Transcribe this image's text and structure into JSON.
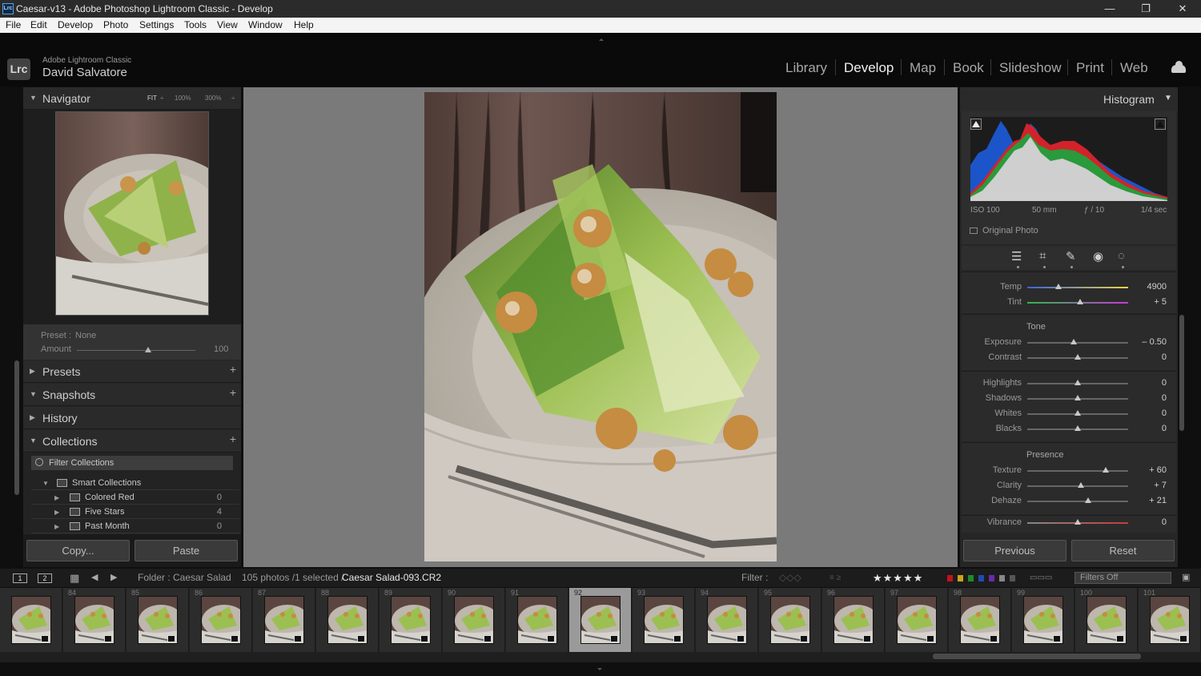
{
  "window": {
    "title": "Caesar-v13 - Adobe Photoshop Lightroom Classic - Develop",
    "icon_text": "Lrc"
  },
  "menu": [
    "File",
    "Edit",
    "Develop",
    "Photo",
    "Settings",
    "Tools",
    "View",
    "Window",
    "Help"
  ],
  "identity": {
    "logo": "Lrc",
    "app": "Adobe Lightroom Classic",
    "user": "David Salvatore"
  },
  "modules": [
    "Library",
    "Develop",
    "Map",
    "Book",
    "Slideshow",
    "Print",
    "Web"
  ],
  "active_module": "Develop",
  "navigator": {
    "title": "Navigator",
    "zoom": [
      "FIT",
      "100%",
      "300%"
    ],
    "zoom_selected": "FIT"
  },
  "preset": {
    "label": "Preset :",
    "value": "None",
    "amount_label": "Amount",
    "amount_value": "100",
    "amount_fraction": 0.6
  },
  "panels": {
    "presets": "Presets",
    "snapshots": "Snapshots",
    "history": "History",
    "collections": "Collections"
  },
  "collections": {
    "filter_placeholder": "Filter Collections",
    "smart": "Smart Collections",
    "items": [
      {
        "name": "Colored Red",
        "count": "0"
      },
      {
        "name": "Five Stars",
        "count": "4"
      },
      {
        "name": "Past Month",
        "count": "0"
      }
    ]
  },
  "left_buttons": {
    "copy": "Copy...",
    "paste": "Paste"
  },
  "histogram": {
    "title": "Histogram",
    "exif": {
      "iso": "ISO 100",
      "focal": "50 mm",
      "aperture": "ƒ / 10",
      "shutter": "1/4 sec"
    },
    "original_photo": "Original Photo"
  },
  "basic": {
    "sliders_top": [
      {
        "label": "Temp",
        "value": "4900",
        "pos": 0.31
      },
      {
        "label": "Tint",
        "value": "+ 5",
        "pos": 0.52
      }
    ],
    "tone_label": "Tone",
    "tone": [
      {
        "label": "Exposure",
        "value": "– 0.50",
        "pos": 0.46
      },
      {
        "label": "Contrast",
        "value": "0",
        "pos": 0.5
      }
    ],
    "tone2": [
      {
        "label": "Highlights",
        "value": "0",
        "pos": 0.5
      },
      {
        "label": "Shadows",
        "value": "0",
        "pos": 0.5
      },
      {
        "label": "Whites",
        "value": "0",
        "pos": 0.5
      },
      {
        "label": "Blacks",
        "value": "0",
        "pos": 0.5
      }
    ],
    "presence_label": "Presence",
    "presence": [
      {
        "label": "Texture",
        "value": "+ 60",
        "pos": 0.78
      },
      {
        "label": "Clarity",
        "value": "+ 7",
        "pos": 0.53
      },
      {
        "label": "Dehaze",
        "value": "+ 21",
        "pos": 0.6
      }
    ],
    "vibrance": {
      "label": "Vibrance",
      "value": "0",
      "pos": 0.5
    }
  },
  "right_buttons": {
    "previous": "Previous",
    "reset": "Reset"
  },
  "filmstrip_bar": {
    "screen1": "1",
    "screen2": "2",
    "folder": "Folder : Caesar Salad",
    "count": "105 photos /1 selected /",
    "file": "Caesar Salad-093.CR2",
    "filter_label": "Filter :",
    "stars": "★★★★★",
    "filters_off": "Filters Off"
  },
  "filmstrip": {
    "numbers": [
      "",
      "84",
      "85",
      "86",
      "87",
      "88",
      "89",
      "90",
      "91",
      "92",
      "93",
      "94",
      "95",
      "96",
      "97",
      "98",
      "99",
      "100",
      "101"
    ],
    "selected_index": 9
  },
  "colors": {
    "accent": "#f0f0f0",
    "panel": "#262626",
    "center": "#7a7a7a",
    "label_red": "#c0141b",
    "label_yellow": "#c9a51a",
    "label_green": "#1e8a2a",
    "label_blue": "#1f4bb0",
    "label_purple": "#6a2aa8"
  }
}
